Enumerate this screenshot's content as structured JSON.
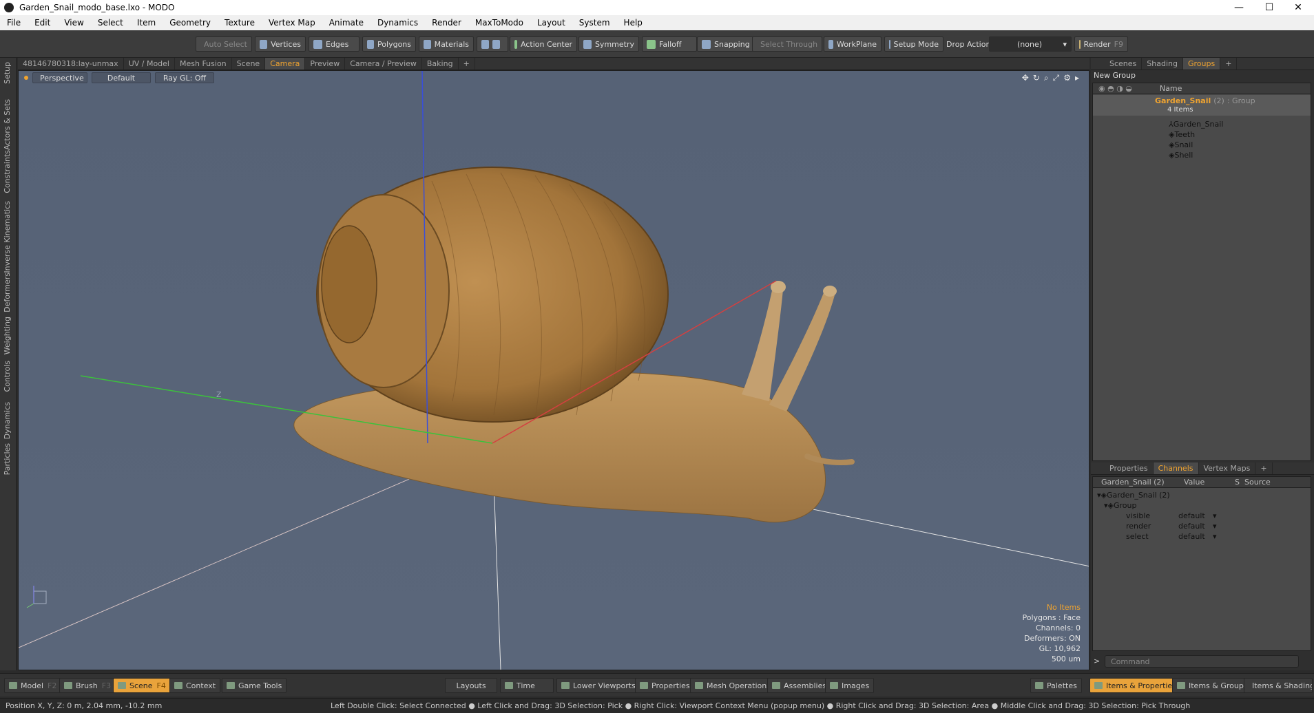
{
  "window": {
    "title": "Garden_Snail_modo_base.lxo - MODO",
    "minimize": "—",
    "maximize": "☐",
    "close": "✕"
  },
  "menu": [
    "File",
    "Edit",
    "View",
    "Select",
    "Item",
    "Geometry",
    "Texture",
    "Vertex Map",
    "Animate",
    "Dynamics",
    "Render",
    "MaxToModo",
    "Layout",
    "System",
    "Help"
  ],
  "toolbar": {
    "auto_select": "Auto Select",
    "vertices": "Vertices",
    "edges": "Edges",
    "polygons": "Polygons",
    "materials": "Materials",
    "action_center": "Action Center",
    "symmetry": "Symmetry",
    "falloff": "Falloff",
    "snapping": "Snapping",
    "select_through": "Select Through",
    "workplane": "WorkPlane",
    "setup_mode": "Setup Mode",
    "drop_action": "Drop Action",
    "drop_value": "(none)",
    "render": "Render",
    "render_key": "F9"
  },
  "left_tabs": [
    "Setup",
    "Actors & Sets",
    "Constraints",
    "Inverse Kinematics",
    "Deformers",
    "Weighting",
    "Controls",
    "Dynamics",
    "Particles"
  ],
  "viewport_tabs": {
    "items": [
      "48146780318:lay-unmax",
      "UV / Model",
      "Mesh Fusion",
      "Scene",
      "Camera",
      "Preview",
      "Camera / Preview",
      "Baking",
      "+"
    ],
    "active": "Camera"
  },
  "viewport": {
    "view": "Perspective",
    "shading": "Default",
    "raygl": "Ray GL: Off",
    "axis_label": "Z",
    "info": {
      "items": "No Items",
      "polygons": "Polygons : Face",
      "channels": "Channels: 0",
      "deformers": "Deformers: ON",
      "gl": "GL: 10,962",
      "unit": "500 um"
    }
  },
  "groups_panel": {
    "tabs": [
      "Scenes",
      "Shading",
      "Groups",
      "+"
    ],
    "active": "Groups",
    "new_group": "New Group",
    "col_name": "Name",
    "root": {
      "name": "Garden_Snail",
      "count": "(2)",
      "type": ": Group",
      "subtitle": "4 Items"
    },
    "children": [
      "Garden_Snail",
      "Teeth",
      "Snail",
      "Shell"
    ]
  },
  "channels_panel": {
    "tabs": [
      "Properties",
      "Channels",
      "Vertex Maps",
      "+"
    ],
    "active": "Channels",
    "headers": {
      "name": "Garden_Snail (2)",
      "value": "Value",
      "s": "S",
      "source": "Source"
    },
    "tree": [
      {
        "label": "Garden_Snail (2)"
      },
      {
        "label": "Group"
      }
    ],
    "rows": [
      {
        "name": "visible",
        "value": "default"
      },
      {
        "name": "render",
        "value": "default"
      },
      {
        "name": "select",
        "value": "default"
      }
    ],
    "command_placeholder": "Command",
    "prompt": ">"
  },
  "bottom_tabs": {
    "left": [
      {
        "label": "Model",
        "key": "F2"
      },
      {
        "label": "Brush",
        "key": "F3"
      },
      {
        "label": "Scene",
        "key": "F4"
      },
      {
        "label": "Context",
        "key": ""
      },
      {
        "label": "Game Tools",
        "key": ""
      }
    ],
    "center": [
      "Layouts",
      "Time",
      "Lower Viewports",
      "Properties",
      "Mesh Operations",
      "Assemblies",
      "Images"
    ],
    "right": [
      "Palettes",
      "Items & Properties",
      "Items & Groups",
      "Items & Shading"
    ],
    "active": "Scene",
    "active_right": "Items & Properties"
  },
  "status": {
    "position": "Position X, Y, Z:   0 m, 2.04 mm, -10.2 mm",
    "hint": "Left Double Click: Select Connected ● Left Click and Drag: 3D Selection: Pick ● Right Click: Viewport Context Menu (popup menu) ● Right Click and Drag: 3D Selection: Area ● Middle Click and Drag: 3D Selection: Pick Through"
  },
  "colors": {
    "accent": "#f0a430",
    "viewport_bg": "#586478",
    "axis_x": "#d44040",
    "axis_y": "#3a4fd8",
    "axis_z": "#3cc13c",
    "shell": "#a57a40",
    "body": "#b58a52"
  }
}
